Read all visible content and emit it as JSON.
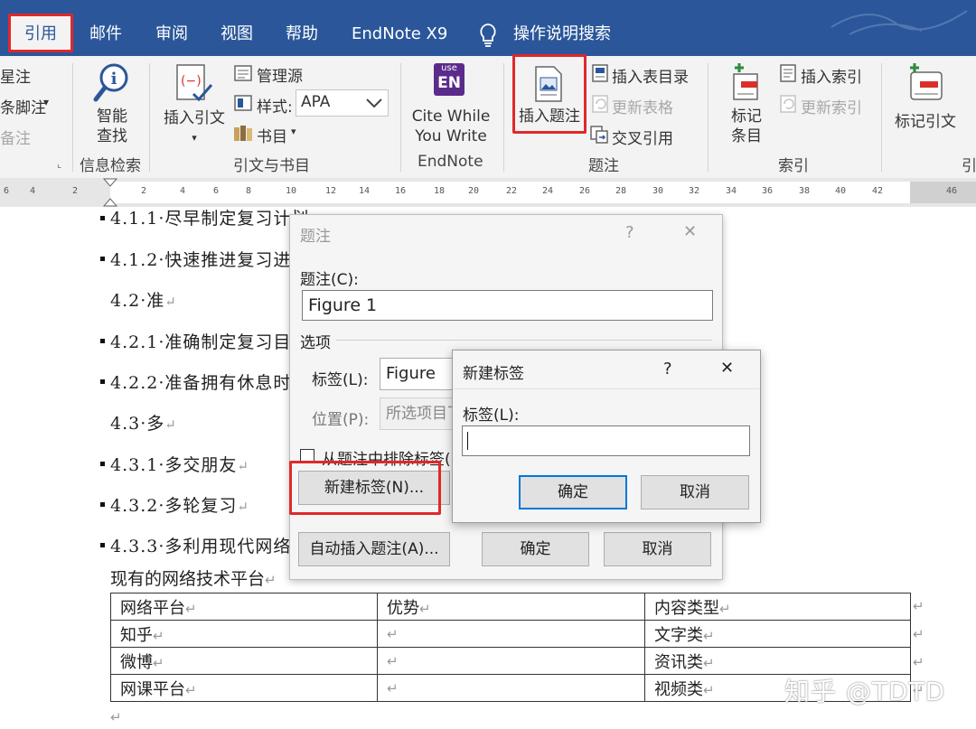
{
  "tabs": [
    {
      "label": "引用",
      "active": true
    },
    {
      "label": "邮件"
    },
    {
      "label": "审阅"
    },
    {
      "label": "视图"
    },
    {
      "label": "帮助"
    },
    {
      "label": "EndNote X9"
    }
  ],
  "tell_me": "操作说明搜索",
  "ribbon": {
    "footnotes": {
      "item1": "星注",
      "item2": "条脚注",
      "item3": "备注"
    },
    "research": {
      "button": [
        "智能",
        "查找"
      ],
      "group": "信息检索"
    },
    "citations": {
      "insert_citation": "插入引文",
      "manage_sources": "管理源",
      "style_label": "样式:",
      "style_value": "APA",
      "bibliography": "书目",
      "group": "引文与书目"
    },
    "endnote": {
      "logo_top": "use",
      "logo_main": "EN",
      "button": [
        "Cite While",
        "You Write"
      ],
      "group": "EndNote"
    },
    "captions": {
      "insert_caption": "插入题注",
      "insert_tof": "插入表目录",
      "update_table": "更新表格",
      "cross_ref": "交叉引用",
      "group": "题注"
    },
    "index": {
      "mark_entry": [
        "标记",
        "条目"
      ],
      "insert_index": "插入索引",
      "update_index": "更新索引",
      "group": "索引"
    },
    "toa": {
      "mark_citation": "标记引文",
      "group": "引"
    }
  },
  "ruler": [
    "6",
    "4",
    "2",
    "2",
    "4",
    "6",
    "8",
    "10",
    "12",
    "14",
    "16",
    "18",
    "20",
    "22",
    "24",
    "26",
    "28",
    "30",
    "32",
    "34",
    "36",
    "38",
    "40",
    "42",
    "46"
  ],
  "document": {
    "headings": [
      {
        "text": "4.1.1·尽早制定复习计划",
        "bullet": true
      },
      {
        "text": "4.1.2·快速推进复习进度",
        "bullet": true
      },
      {
        "text": "4.2·准",
        "bullet": false
      },
      {
        "text": "4.2.1·准确制定复习目标",
        "bullet": true
      },
      {
        "text": "4.2.2·准备拥有休息时间",
        "bullet": true
      },
      {
        "text": "4.3·多",
        "bullet": false
      },
      {
        "text": "4.3.1·多交朋友",
        "bullet": true
      },
      {
        "text": "4.3.2·多轮复习",
        "bullet": true
      },
      {
        "text": "4.3.3·多利用现代网络",
        "bullet": true
      }
    ],
    "paragraph_mark": "↵",
    "table_intro": "现有的网络技术平台",
    "table": [
      [
        "网络平台",
        "优势",
        "内容类型"
      ],
      [
        "知乎",
        "",
        "文字类"
      ],
      [
        "微博",
        "",
        "资讯类"
      ],
      [
        "网课平台",
        "",
        "视频类"
      ]
    ]
  },
  "caption_dialog": {
    "title": "题注",
    "help": "?",
    "close": "✕",
    "caption_label": "题注(C):",
    "caption_value": "Figure 1",
    "options_label": "选项",
    "label_label": "标签(L):",
    "label_value": "Figure",
    "position_label": "位置(P):",
    "position_value": "所选项目下方",
    "exclude_label": "从题注中排除标签(E)",
    "new_label_button": "新建标签(N)...",
    "auto_caption_button": "自动插入题注(A)...",
    "ok": "确定",
    "cancel": "取消"
  },
  "new_label_dialog": {
    "title": "新建标签",
    "help": "?",
    "close": "✕",
    "label_label": "标签(L):",
    "label_value": "",
    "ok": "确定",
    "cancel": "取消"
  },
  "watermark": "知乎 @TDTD"
}
